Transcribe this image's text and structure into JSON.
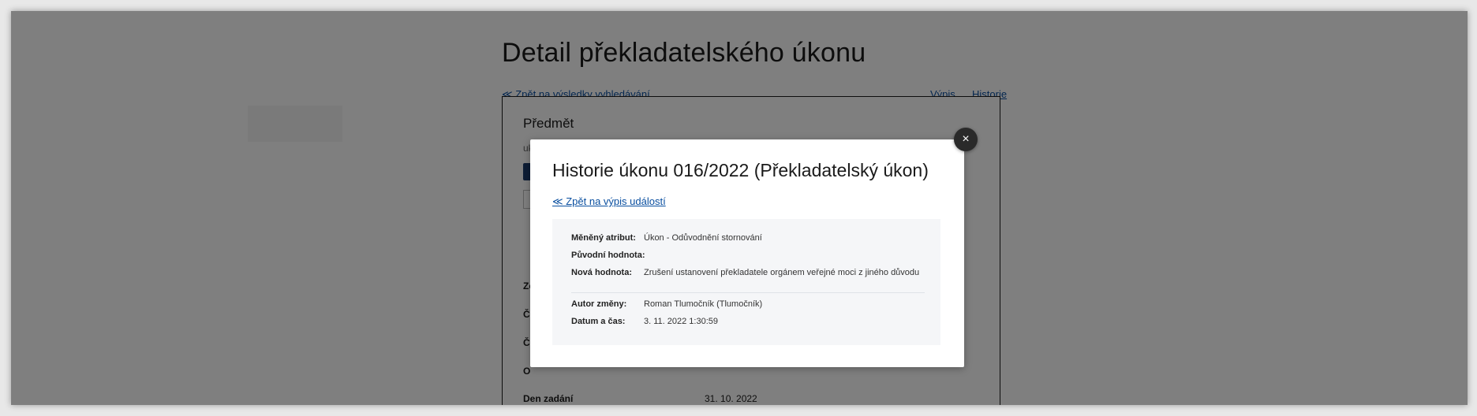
{
  "page": {
    "title": "Detail překladatelského úkonu",
    "back_link": "≪ Zpět na výsledky vyhledávání",
    "nav": {
      "vypis": "Výpis",
      "historie": "Historie"
    }
  },
  "detail": {
    "heading": "Předmět",
    "sub_text": "uk",
    "rows": [
      {
        "label": "Zo",
        "value": ""
      },
      {
        "label": "Čí",
        "value": ""
      },
      {
        "label": "Čí",
        "value": ""
      },
      {
        "label": "O",
        "value": ""
      },
      {
        "label": "Den zadání",
        "value": "31. 10. 2022"
      }
    ]
  },
  "modal": {
    "title": "Historie úkonu 016/2022 (Překladatelský úkon)",
    "back_link": "≪ Zpět na výpis událostí",
    "close_icon": "×",
    "change": {
      "attribute_label": "Měněný atribut:",
      "attribute_value": "Úkon - Odůvodnění stornování",
      "original_label": "Původní hodnota:",
      "original_value": "",
      "new_label": "Nová hodnota:",
      "new_value": "Zrušení ustanovení překladatele orgánem veřejné moci z jiného důvodu",
      "author_label": "Autor změny:",
      "author_value": "Roman Tlumočník (Tlumočník)",
      "datetime_label": "Datum a čas:",
      "datetime_value": "3. 11. 2022 1:30:59"
    }
  }
}
